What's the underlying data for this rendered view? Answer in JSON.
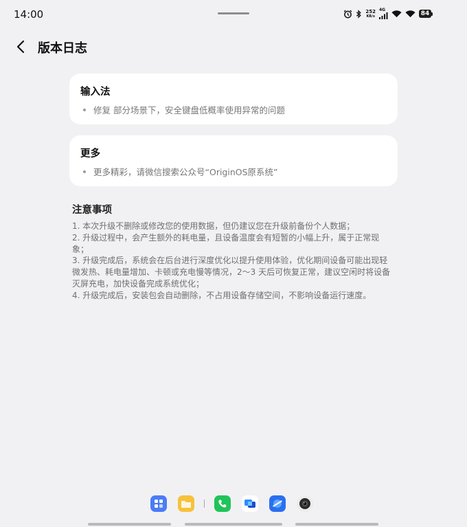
{
  "status_bar": {
    "time": "14:00",
    "net_speed_value": "252",
    "net_speed_unit": "KB/s",
    "network_type": "4G",
    "battery_level": "84",
    "icons": [
      "alarm-icon",
      "bluetooth-icon",
      "signal-icon",
      "wifi-icon",
      "wifi-icon",
      "battery-icon"
    ]
  },
  "header": {
    "back_icon": "chevron-left-icon",
    "title": "版本日志"
  },
  "cards": [
    {
      "title": "输入法",
      "items": [
        "修复 部分场景下，安全键盘低概率使用异常的问题"
      ]
    },
    {
      "title": "更多",
      "items": [
        "更多精彩，请微信搜索公众号“OriginOS原系统”"
      ]
    }
  ],
  "notes": {
    "title": "注意事项",
    "lines": [
      "1. 本次升级不删除或修改您的使用数据，但仍建议您在升级前备份个人数据；",
      "2. 升级过程中，会产生额外的耗电量，且设备温度会有短暂的小幅上升，属于正常现",
      "象；",
      "3. 升级完成后，系统会在后台进行深度优化以提升使用体验，优化期间设备可能出现轻",
      "微发热、耗电量增加、卡顿或充电慢等情况，2～3 天后可恢复正常，建议空闲时将设备",
      "灭屏充电，加快设备完成系统优化；",
      "4. 升级完成后，安装包会自动删除，不占用设备存储空间，不影响设备运行速度。"
    ]
  },
  "dock": {
    "apps": [
      "app-grid-icon",
      "file-manager-icon",
      "phone-icon",
      "messages-icon",
      "browser-icon",
      "camera-icon"
    ],
    "colors": {
      "app_grid": "#4a7cf5",
      "files": "#f6c23b",
      "phone": "#1fc45a",
      "messages": "#2d8cff",
      "browser": "#2a6ff0",
      "camera": "#2b2b2b"
    }
  }
}
